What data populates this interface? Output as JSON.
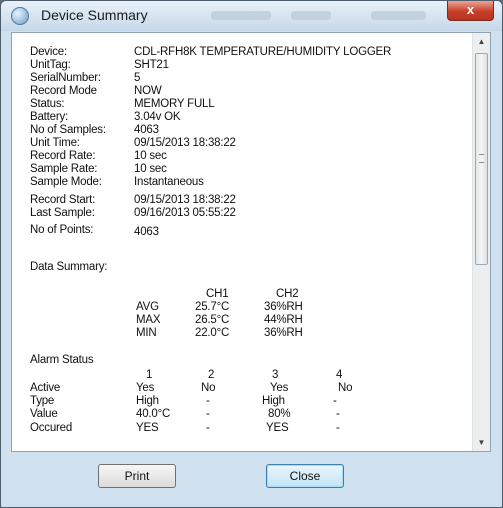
{
  "window": {
    "title": "Device Summary",
    "close_glyph": "x"
  },
  "device_info": [
    {
      "label": "Device:",
      "value": "CDL-RFH8K TEMPERATURE/HUMIDITY LOGGER"
    },
    {
      "label": "UnitTag:",
      "value": "SHT21"
    },
    {
      "label": "SerialNumber:",
      "value": "5"
    },
    {
      "label": "Record Mode",
      "value": "NOW"
    },
    {
      "label": "Status:",
      "value": "MEMORY FULL"
    },
    {
      "label": "Battery:",
      "value": "3.04v OK"
    },
    {
      "label": "No of Samples:",
      "value": "4063"
    },
    {
      "label": "Unit Time:",
      "value": "09/15/2013 18:38:22"
    },
    {
      "label": "Record Rate:",
      "value": "10 sec"
    },
    {
      "label": "Sample Rate:",
      "value": "10 sec"
    },
    {
      "label": "Sample Mode:",
      "value": "Instantaneous"
    },
    {
      "label": "Record Start:",
      "value": "09/15/2013 18:38:22"
    },
    {
      "label": "Last Sample:",
      "value": "09/16/2013 05:55:22"
    },
    {
      "label": "No of Points:",
      "value": "4063"
    }
  ],
  "data_summary": {
    "heading": "Data Summary:",
    "columns": [
      "CH1",
      "CH2"
    ],
    "rows": [
      {
        "name": "AVG",
        "ch1": "25.7°C",
        "ch2": "36%RH"
      },
      {
        "name": "MAX",
        "ch1": "26.5°C",
        "ch2": "44%RH"
      },
      {
        "name": "MIN",
        "ch1": "22.0°C",
        "ch2": "36%RH"
      }
    ]
  },
  "alarm_status": {
    "heading": "Alarm Status",
    "columns": [
      "1",
      "2",
      "3",
      "4"
    ],
    "rows": [
      {
        "name": "Active",
        "values": [
          "Yes",
          "No",
          "Yes",
          "No"
        ]
      },
      {
        "name": "Type",
        "values": [
          "High",
          "-",
          "High",
          "-"
        ]
      },
      {
        "name": "Value",
        "values": [
          "40.0°C",
          "-",
          "80%",
          "-"
        ]
      },
      {
        "name": "Occured",
        "values": [
          "YES",
          "-",
          "YES",
          "-"
        ]
      }
    ]
  },
  "buttons": {
    "print": "Print",
    "close": "Close"
  },
  "scrollbar": {
    "up_glyph": "▲",
    "down_glyph": "▼"
  }
}
